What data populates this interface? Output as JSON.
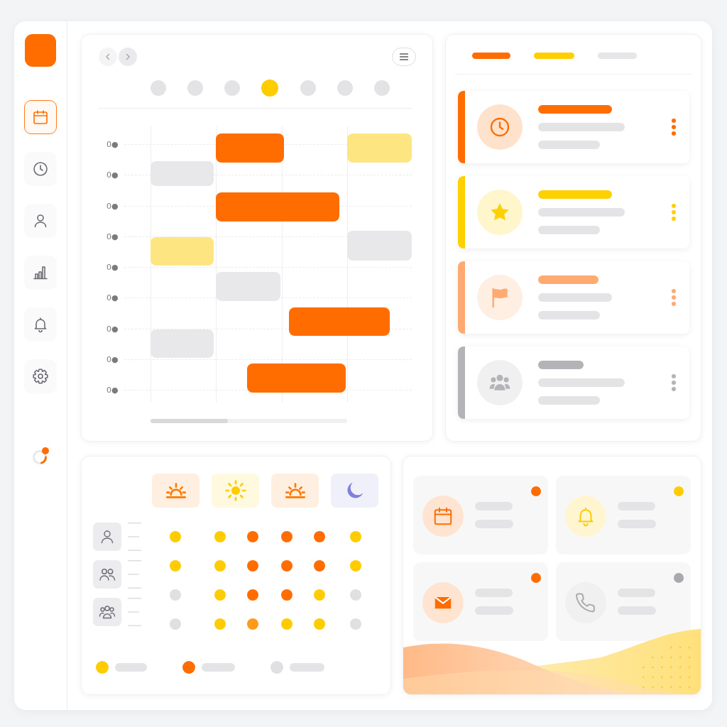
{
  "sidebar": {
    "items": [
      {
        "selected": true
      },
      {
        "selected": false
      },
      {
        "selected": false
      },
      {
        "selected": false
      },
      {
        "selected": false
      },
      {
        "selected": false
      }
    ]
  },
  "schedule": {
    "days": [
      {
        "selected": false
      },
      {
        "selected": false
      },
      {
        "selected": false
      },
      {
        "selected": true
      },
      {
        "selected": false
      },
      {
        "selected": false
      },
      {
        "selected": false
      }
    ],
    "time_labels": [
      "0●",
      "0●",
      "0●",
      "0●",
      "0●",
      "0●",
      "0●",
      "0●",
      "0●"
    ],
    "events": [
      {
        "color": "#ff6d00"
      },
      {
        "color": "#fde581"
      },
      {
        "color": "#e8e8ea"
      },
      {
        "color": "#ff6d00"
      },
      {
        "color": "#e8e8ea"
      },
      {
        "color": "#fde581"
      },
      {
        "color": "#e8e8ea"
      },
      {
        "color": "#ff6d00"
      },
      {
        "color": "#e8e8ea"
      },
      {
        "color": "#ff6d00"
      }
    ]
  },
  "activity": {
    "tabs": [
      {
        "color": "#ff6d00"
      },
      {
        "color": "#ffd000"
      },
      {
        "color": "#e6e6e8"
      }
    ],
    "cards": [
      {
        "color": "#ff6d00"
      },
      {
        "color": "#ffd000"
      },
      {
        "color": "#ffaa70"
      },
      {
        "color": "#b4b4b8"
      }
    ]
  },
  "availability": {
    "periods": [
      {
        "color": "#ff7a00"
      },
      {
        "color": "#ffcc00"
      },
      {
        "color": "#ff7a00"
      },
      {
        "color": "#7f7fdc"
      }
    ],
    "grid": [
      {
        "cells": [
          {
            "color": "#ffcc00"
          },
          {
            "color": "#ffcc00"
          },
          {
            "color": "#ff6d00"
          },
          {
            "color": "#ff6d00"
          },
          {
            "color": "#ff6d00"
          },
          {
            "color": "#ffcc00"
          }
        ]
      },
      {
        "cells": [
          {
            "color": "#ffcc00"
          },
          {
            "color": "#ffcc00"
          },
          {
            "color": "#ff6d00"
          },
          {
            "color": "#ff6d00"
          },
          {
            "color": "#ff6d00"
          },
          {
            "color": "#ffcc00"
          }
        ]
      },
      {
        "cells": [
          {
            "color": "#e0e0e3"
          },
          {
            "color": "#ffcc00"
          },
          {
            "color": "#ff6d00"
          },
          {
            "color": "#ff6d00"
          },
          {
            "color": "#ffcc00"
          },
          {
            "color": "#e0e0e3"
          }
        ]
      },
      {
        "cells": [
          {
            "color": "#e0e0e3"
          },
          {
            "color": "#ffcc00"
          },
          {
            "color": "#ff9a1a"
          },
          {
            "color": "#ffcc00"
          },
          {
            "color": "#ffcc00"
          },
          {
            "color": "#e0e0e3"
          }
        ]
      }
    ],
    "legend": [
      {
        "color": "#ffcc00"
      },
      {
        "color": "#ff6d00"
      },
      {
        "color": "#e0e0e3"
      }
    ]
  },
  "contacts": {
    "tiles": [
      {
        "color": "#ff6d00"
      },
      {
        "color": "#ffcc00"
      },
      {
        "color": "#ff6d00"
      },
      {
        "color": "#a9a9ad"
      }
    ]
  }
}
